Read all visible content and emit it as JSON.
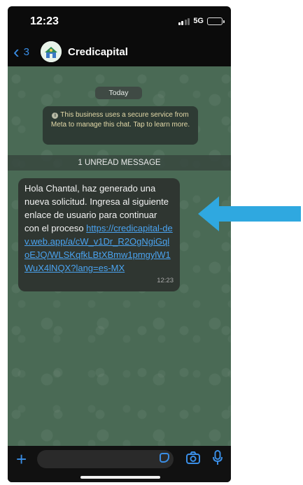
{
  "status": {
    "time": "12:23",
    "network": "5G"
  },
  "nav": {
    "back_count": "3",
    "contact_name": "Credicapital"
  },
  "chat": {
    "date_label": "Today",
    "system_notice": "This business uses a secure service from Meta to manage this chat. Tap to learn more.",
    "unread_label": "1 UNREAD MESSAGE",
    "message": {
      "text": "Hola Chantal, haz generado una nueva solicitud. Ingresa al siguiente enlace de usuario para continuar con el proceso ",
      "link": "https://credicapital-dev.web.app/a/cW_v1Dr_R2OgNgiGqloEJQ/WLSKqfkLBtXBmw1pmgylW1WuX4lNQX?lang=es-MX",
      "time": "12:23"
    }
  },
  "composer": {
    "placeholder": ""
  },
  "colors": {
    "accent": "#3a8ee6",
    "arrow": "#2fa8e0",
    "chat_bg": "#4a6a55",
    "bubble": "#2f3631",
    "link": "#4aa3f0"
  },
  "icons": [
    "chevron-left-icon",
    "info-icon",
    "plus-icon",
    "sticker-icon",
    "camera-icon",
    "microphone-icon",
    "arrow-left-icon"
  ]
}
